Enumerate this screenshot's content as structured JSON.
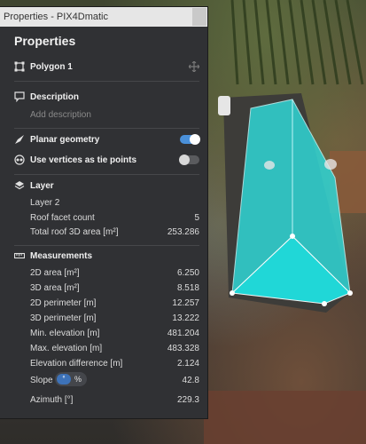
{
  "window": {
    "title": "Properties - PIX4Dmatic"
  },
  "panel": {
    "heading": "Properties"
  },
  "object": {
    "name": "Polygon 1"
  },
  "description": {
    "label": "Description",
    "placeholder": "Add description"
  },
  "planar_geometry": {
    "label": "Planar geometry",
    "enabled": true
  },
  "tie_points": {
    "label": "Use vertices as tie points",
    "enabled": false
  },
  "layer": {
    "label": "Layer",
    "name": "Layer 2",
    "roof_facet_count_label": "Roof facet count",
    "roof_facet_count": "5",
    "total_area_label": "Total roof 3D area [m²]",
    "total_area": "253.286"
  },
  "measurements": {
    "label": "Measurements",
    "rows": [
      {
        "label": "2D area [m²]",
        "value": "6.250"
      },
      {
        "label": "3D area [m²]",
        "value": "8.518"
      },
      {
        "label": "2D perimeter [m]",
        "value": "12.257"
      },
      {
        "label": "3D perimeter [m]",
        "value": "13.222"
      },
      {
        "label": "Min. elevation [m]",
        "value": "481.204"
      },
      {
        "label": "Max. elevation [m]",
        "value": "483.328"
      },
      {
        "label": "Elevation difference [m]",
        "value": "2.124"
      }
    ],
    "slope_label": "Slope",
    "slope_unit_deg": "°",
    "slope_unit_pct": "%",
    "slope_value": "42.8",
    "azimuth_label": "Azimuth [°]",
    "azimuth_value": "229.3"
  },
  "colors": {
    "accent": "#4a90d9",
    "roof_highlight": "#2fd6d6",
    "panel_bg": "#303134"
  }
}
